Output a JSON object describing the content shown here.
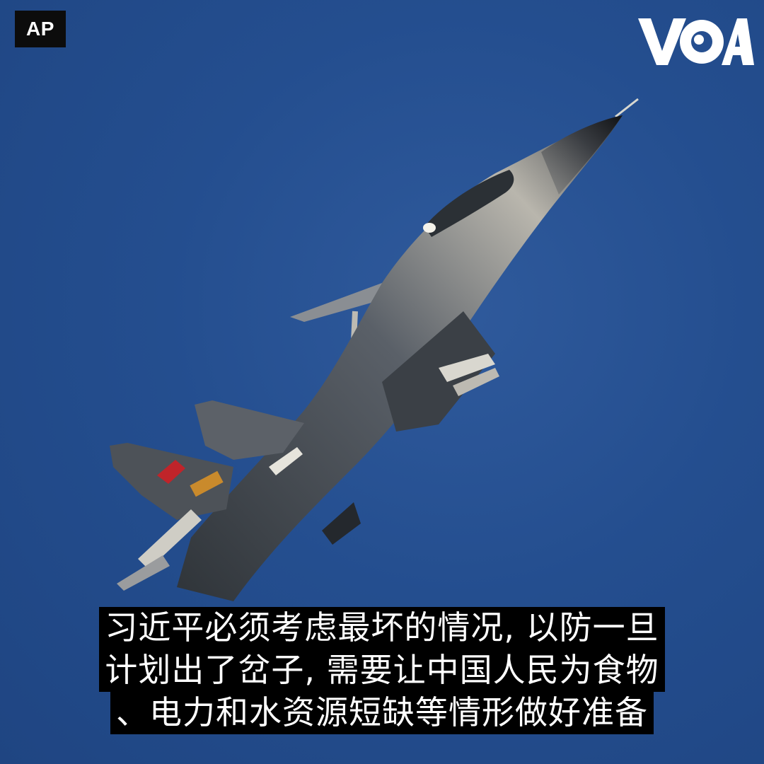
{
  "credit": {
    "label": "AP"
  },
  "logo": {
    "text": "VOA",
    "color": "#ffffff"
  },
  "caption": {
    "lines": [
      "习近平必须考虑最坏的情况, 以防一旦",
      "计划出了岔子, 需要让中国人民为食物",
      "、电力和水资源短缺等情形做好准备"
    ]
  },
  "colors": {
    "sky": "#244e8f",
    "jet_body": "#7d8289",
    "roundel_red": "#c0242a"
  }
}
